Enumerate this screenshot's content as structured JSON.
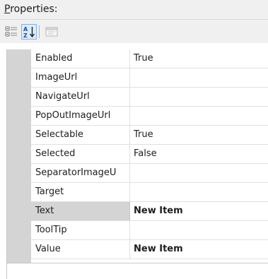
{
  "header": {
    "mnemonic": "P",
    "rest": "roperties:"
  },
  "toolbar": {
    "buttons": [
      {
        "name": "categorized",
        "icon": "categorized-icon",
        "pressed": false
      },
      {
        "name": "alphabetical",
        "icon": "sort-az-icon",
        "pressed": true
      },
      {
        "name": "property-pages",
        "icon": "property-pages-icon",
        "pressed": false
      }
    ],
    "alpha_top": "A",
    "alpha_bottom": "Z"
  },
  "grid": {
    "rows": [
      {
        "name": "Enabled",
        "value": "True",
        "bold": false,
        "selected": false
      },
      {
        "name": "ImageUrl",
        "value": "",
        "bold": false,
        "selected": false
      },
      {
        "name": "NavigateUrl",
        "value": "",
        "bold": false,
        "selected": false
      },
      {
        "name": "PopOutImageUrl",
        "value": "",
        "bold": false,
        "selected": false
      },
      {
        "name": "Selectable",
        "value": "True",
        "bold": false,
        "selected": false
      },
      {
        "name": "Selected",
        "value": "False",
        "bold": false,
        "selected": false
      },
      {
        "name": "SeparatorImageU",
        "value": "",
        "bold": false,
        "selected": false
      },
      {
        "name": "Target",
        "value": "",
        "bold": false,
        "selected": false
      },
      {
        "name": "Text",
        "value": "New Item",
        "bold": true,
        "selected": true
      },
      {
        "name": "ToolTip",
        "value": "",
        "bold": false,
        "selected": false
      },
      {
        "name": "Value",
        "value": "New Item",
        "bold": true,
        "selected": false
      }
    ]
  },
  "colors": {
    "panel_bg": "#f0f0f0",
    "gutter": "#d4d4d4",
    "selected_row": "#d4d4d4",
    "pressed_button_bg": "#dcecfc",
    "pressed_button_border": "#7eb4ea",
    "grid_line": "#e0e0e0"
  }
}
